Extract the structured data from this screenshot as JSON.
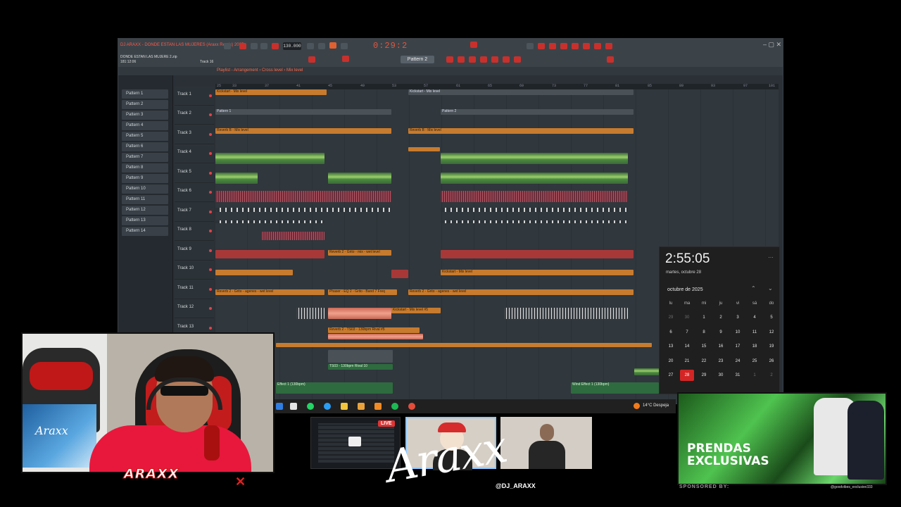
{
  "daw": {
    "song_file": "DONDE ESTAN LAS MUJERE 2.zip",
    "time_pos": "181:12:06",
    "hint_track": "Track 16",
    "title_line": "DJ ARAXX - DONDE ESTAN LAS MUJERES (Araxx Remix) 2025",
    "tempo": "130.000",
    "time_display": "0:29:2",
    "pattern_selector": "Pattern 2",
    "playlist_title": "Playlist - Arrangement › Cross level › Mix level",
    "window_controls": "– ▢ ✕",
    "patterns": [
      "Pattern 1",
      "Pattern 2",
      "Pattern 3",
      "Pattern 4",
      "Pattern 5",
      "Pattern 6",
      "Pattern 7",
      "Pattern 8",
      "Pattern 9",
      "Pattern 10",
      "Pattern 11",
      "Pattern 12",
      "Pattern 13",
      "Pattern 14"
    ],
    "tracks": [
      "Track 1",
      "Track 2",
      "Track 3",
      "Track 4",
      "Track 5",
      "Track 6",
      "Track 7",
      "Track 8",
      "Track 9",
      "Track 10",
      "Track 11",
      "Track 12",
      "Track 13"
    ],
    "ruler": [
      "25",
      "33",
      "37",
      "41",
      "45",
      "49",
      "53",
      "57",
      "61",
      "65",
      "69",
      "73",
      "77",
      "81",
      "85",
      "89",
      "93",
      "97",
      "101"
    ],
    "clip_labels": {
      "kickstart": "Kickstart - Mix level",
      "pattern1": "Pattern 1",
      "pattern2": "Pattern 2",
      "pattern3": "Pattern 3",
      "reverb_b": "Reverb B - Mix level",
      "reverb_d": "Reverb 2 - Grito - mix - wet level",
      "reverb_vox": "Reverb 2 - Grito - agenes - wet level",
      "reverb_t": "Reverb 2 - TS03 - 130bpm Rival #5",
      "kickstart2": "Kickstart - Mix level #5",
      "filter": "Phaser - EQ 2 - Grito - Band 7 Freq",
      "vocal_main": "TS03 - 130bpm Rival 10",
      "effect1": "Effect 1 (130bpm)",
      "effect2": "Wind Effect 1 (130bpm)"
    }
  },
  "calendar": {
    "time": "2:55:05",
    "date": "martes, octubre 28",
    "more_icon": "…",
    "month": "octubre de 2025",
    "nav_up": "⌃",
    "nav_down": "⌄",
    "weekdays": [
      "lu",
      "ma",
      "mi",
      "ju",
      "vi",
      "sá",
      "do"
    ],
    "weeks": [
      [
        "29",
        "30",
        "1",
        "2",
        "3",
        "4",
        "5"
      ],
      [
        "6",
        "7",
        "8",
        "9",
        "10",
        "11",
        "12"
      ],
      [
        "13",
        "14",
        "15",
        "16",
        "17",
        "18",
        "19"
      ],
      [
        "20",
        "21",
        "22",
        "23",
        "24",
        "25",
        "26"
      ],
      [
        "27",
        "28",
        "29",
        "30",
        "31",
        "1",
        "2"
      ]
    ],
    "today": "28"
  },
  "taskbar": {
    "weather": "14°C  Despeja"
  },
  "webcam": {
    "poster_text": "Araxx",
    "logo_text": "ARAXX",
    "x_mark": "✕"
  },
  "stream": {
    "live_badge": "LIVE",
    "signature": "Araxx",
    "handle": "@DJ_ARAXX"
  },
  "ad": {
    "line1": "PRENDAS",
    "line2": "EXCLUSIVAS",
    "sponsored": "SPONSORED BY:",
    "handle": "@goodvibes_exclusive333"
  },
  "colors": {
    "accent_red": "#d32525",
    "daw_clip_orange": "#c77b2e",
    "daw_clip_green": "#9bd06b",
    "ad_green": "#4fc34f"
  }
}
